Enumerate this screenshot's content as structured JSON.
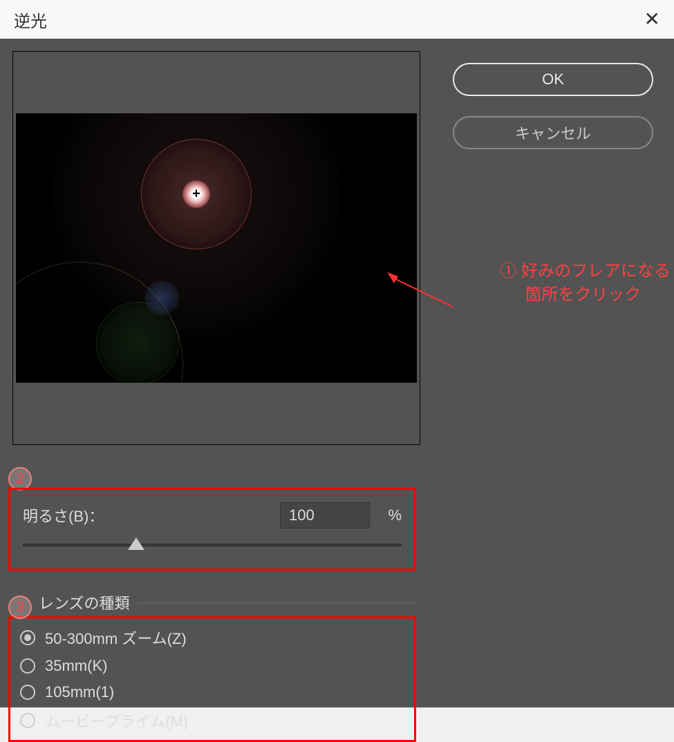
{
  "title": "逆光",
  "buttons": {
    "ok": "OK",
    "cancel": "キャンセル"
  },
  "annotations": {
    "step1_line1": "① 好みのフレアになる",
    "step1_line2": "箇所をクリック",
    "step2": "2",
    "step3": "3"
  },
  "brightness": {
    "label": "明るさ(B)：",
    "value": "100",
    "unit": "%"
  },
  "lens": {
    "group_label": "レンズの種類",
    "options": [
      {
        "label": "50-300mm ズーム(Z)",
        "checked": true
      },
      {
        "label": "35mm(K)",
        "checked": false
      },
      {
        "label": "105mm(1)",
        "checked": false
      },
      {
        "label": "ムービープライム(M)",
        "checked": false
      }
    ]
  }
}
